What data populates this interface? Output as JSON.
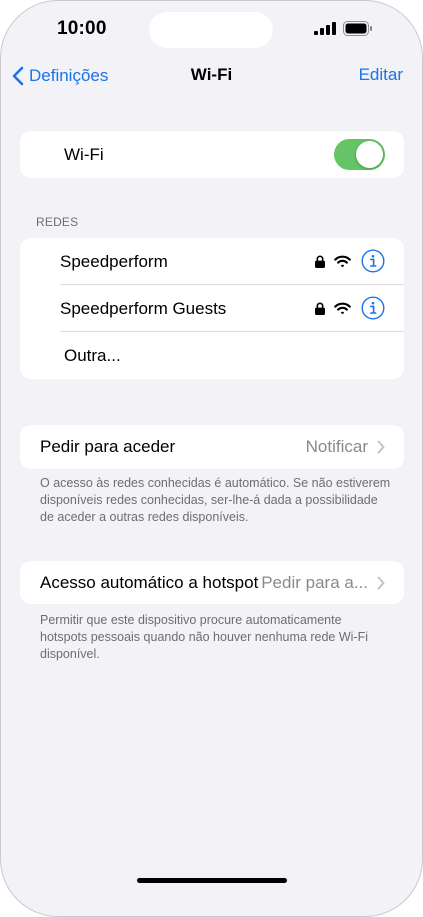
{
  "status_bar": {
    "time": "10:00"
  },
  "nav": {
    "back_label": "Definições",
    "title": "Wi-Fi",
    "edit_label": "Editar"
  },
  "wifi": {
    "label": "Wi-Fi",
    "enabled": true
  },
  "networks": {
    "header": "REDES",
    "items": [
      {
        "name": "Speedperform"
      },
      {
        "name": "Speedperform Guests"
      }
    ],
    "other_label": "Outra..."
  },
  "ask_to_join": {
    "label": "Pedir para aceder",
    "value": "Notificar",
    "footer": "O acesso às redes conhecidas é automático. Se não estiverem disponíveis redes conhecidas, ser-lhe-á dada a possibilidade de aceder a outras redes disponíveis."
  },
  "auto_hotspot": {
    "label": "Acesso automático a hotspot",
    "value": "Pedir para a...",
    "footer": "Permitir que este dispositivo procure automaticamente hotspots pessoais quando não houver nenhuma rede Wi-Fi disponível."
  },
  "colors": {
    "accent": "#1a73e8",
    "toggle_on": "#65c466",
    "background": "#f2f2f7",
    "secondary_text": "#6d6d72"
  },
  "icons": [
    "chevron-left-icon",
    "lock-icon",
    "wifi-icon",
    "info-icon",
    "chevron-right-icon",
    "signal-icon",
    "battery-icon"
  ]
}
